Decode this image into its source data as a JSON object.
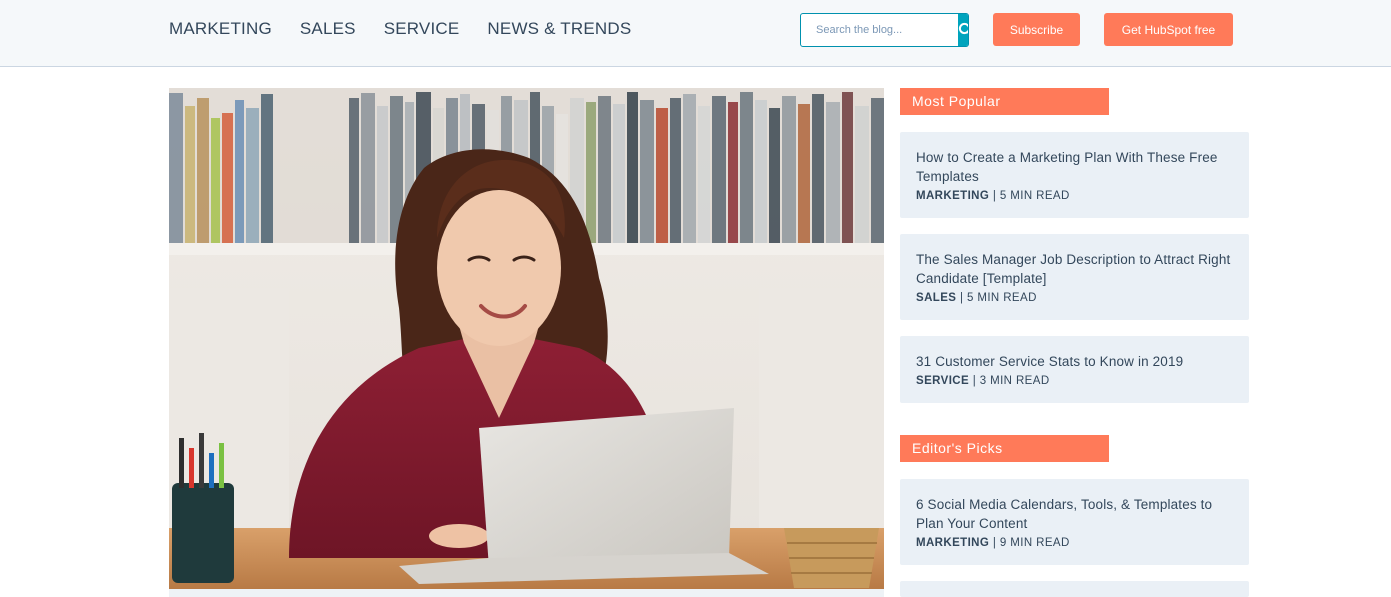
{
  "nav": {
    "items": [
      "MARKETING",
      "SALES",
      "SERVICE",
      "NEWS & TRENDS"
    ]
  },
  "search": {
    "placeholder": "Search the blog...",
    "icon": "search-icon"
  },
  "buttons": {
    "subscribe": "Subscribe",
    "get_hubspot": "Get HubSpot free"
  },
  "hero": {
    "image": "woman-with-laptop-photo"
  },
  "sidebar": {
    "most_popular": {
      "label": "Most Popular",
      "posts": [
        {
          "title": "How to Create a Marketing Plan With These Free Templates",
          "tag": "MARKETING",
          "read": "5 MIN READ"
        },
        {
          "title": "The Sales Manager Job Description to Attract Right Candidate [Template]",
          "tag": "SALES",
          "read": "5 MIN READ"
        },
        {
          "title": "31 Customer Service Stats to Know in 2019",
          "tag": "SERVICE",
          "read": "3 MIN READ"
        }
      ]
    },
    "editors_picks": {
      "label": "Editor's Picks",
      "posts": [
        {
          "title": "6 Social Media Calendars, Tools, & Templates to Plan Your Content",
          "tag": "MARKETING",
          "read": "9 MIN READ"
        }
      ]
    },
    "separator": "|"
  },
  "colors": {
    "accent": "#ff7a59",
    "search_button": "#00a4bd",
    "card_bg": "#eaf0f6",
    "text": "#33475b"
  }
}
